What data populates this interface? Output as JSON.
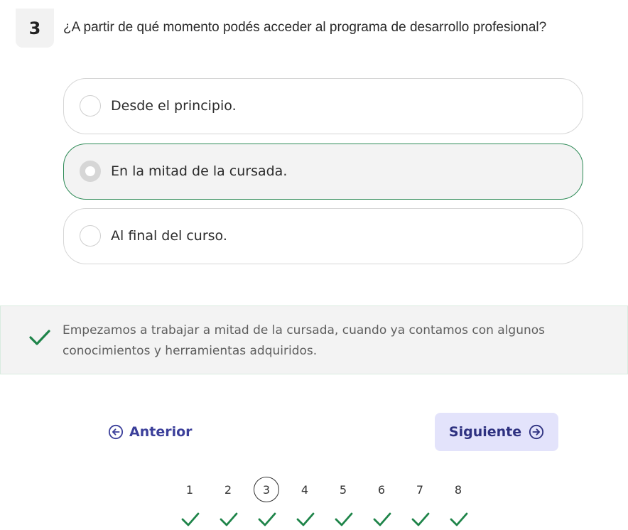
{
  "question": {
    "number": "3",
    "text": "¿A partir de qué momento podés acceder al programa de desarrollo profesional?"
  },
  "options": [
    {
      "label": "Desde el principio.",
      "selected": false
    },
    {
      "label": "En la mitad de la cursada.",
      "selected": true
    },
    {
      "label": "Al final del curso.",
      "selected": false
    }
  ],
  "feedback": {
    "status": "correct",
    "icon": "check-icon",
    "text": "Empezamos a trabajar a mitad de la cursada, cuando ya contamos con algunos conocimientos y herramientas adquiridos."
  },
  "navigation": {
    "prev_label": "Anterior",
    "prev_icon": "arrow-left-circle-icon",
    "next_label": "Siguiente",
    "next_icon": "arrow-right-circle-icon"
  },
  "pagination": {
    "current": 3,
    "pages": [
      {
        "num": "1",
        "answered": true
      },
      {
        "num": "2",
        "answered": true
      },
      {
        "num": "3",
        "answered": true
      },
      {
        "num": "4",
        "answered": true
      },
      {
        "num": "5",
        "answered": true
      },
      {
        "num": "6",
        "answered": true
      },
      {
        "num": "7",
        "answered": true
      },
      {
        "num": "8",
        "answered": true
      }
    ]
  },
  "colors": {
    "accent_green": "#1e8449",
    "nav_text": "#3b3f9a",
    "next_button_bg": "#e3e3fb"
  }
}
